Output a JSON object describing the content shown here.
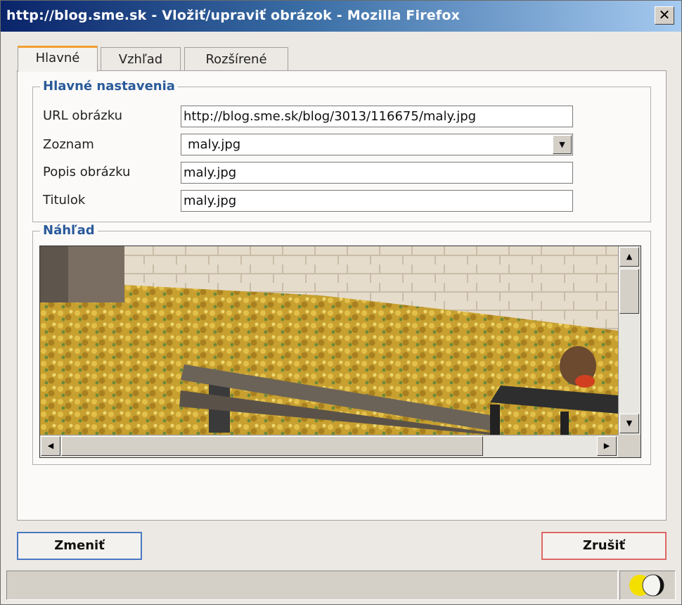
{
  "window": {
    "title": "http://blog.sme.sk - Vložiť/upraviť obrázok - Mozilla Firefox",
    "close_glyph": "✕"
  },
  "tabs": [
    {
      "label": "Hlavné",
      "active": true
    },
    {
      "label": "Vzhľad",
      "active": false
    },
    {
      "label": "Rozšírené",
      "active": false
    }
  ],
  "general": {
    "legend": "Hlavné nastavenia",
    "url_label": "URL obrázku",
    "url_value": "http://blog.sme.sk/blog/3013/116675/maly.jpg",
    "list_label": "Zoznam",
    "list_value": "maly.jpg",
    "desc_label": "Popis obrázku",
    "desc_value": "maly.jpg",
    "title_label": "Titulok",
    "title_value": "maly.jpg"
  },
  "preview": {
    "legend": "Náhľad"
  },
  "buttons": {
    "ok": "Zmeniť",
    "cancel": "Zrušiť"
  },
  "colors": {
    "accent": "#2a5a9a",
    "tab_active": "#f0a030",
    "ok_border": "#4a78c2",
    "cancel_border": "#dd6666"
  },
  "icons": {
    "status": "moon-icon"
  }
}
